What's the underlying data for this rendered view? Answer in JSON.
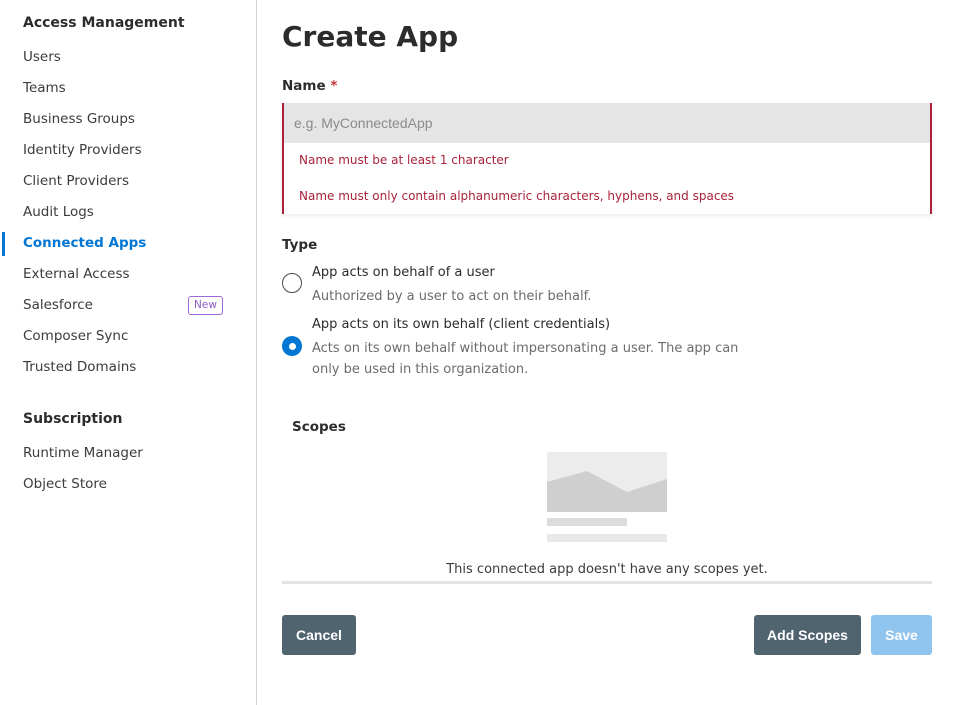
{
  "sidebar": {
    "section1_title": "Access Management",
    "items": [
      {
        "label": "Users"
      },
      {
        "label": "Teams"
      },
      {
        "label": "Business Groups"
      },
      {
        "label": "Identity Providers"
      },
      {
        "label": "Client Providers"
      },
      {
        "label": "Audit Logs"
      },
      {
        "label": "Connected Apps",
        "active": true
      },
      {
        "label": "External Access"
      },
      {
        "label": "Salesforce",
        "badge": "New"
      },
      {
        "label": "Composer Sync"
      },
      {
        "label": "Trusted Domains"
      }
    ],
    "section2_title": "Subscription",
    "items2": [
      {
        "label": "Runtime Manager"
      },
      {
        "label": "Object Store"
      }
    ],
    "accent_color": "#0176d3"
  },
  "main": {
    "title": "Create App",
    "name_field": {
      "label": "Name",
      "required_marker": "*",
      "placeholder": "e.g. MyConnectedApp",
      "value": "",
      "errors": [
        "Name must be at least 1 character",
        "Name must only contain alphanumeric characters, hyphens, and spaces"
      ],
      "error_color": "#a8233a"
    },
    "type": {
      "label": "Type",
      "options": [
        {
          "title": "App acts on behalf of a user",
          "description": "Authorized by a user to act on their behalf.",
          "selected": false
        },
        {
          "title": "App acts on its own behalf (client credentials)",
          "description": "Acts on its own behalf without impersonating a user. The app can only be used in this organization.",
          "selected": true
        }
      ]
    },
    "scopes": {
      "label": "Scopes",
      "empty_message": "This connected app doesn't have any scopes yet.",
      "empty_icon": "image-placeholder-icon"
    },
    "buttons": {
      "cancel": "Cancel",
      "add_scopes": "Add Scopes",
      "save": "Save"
    }
  }
}
